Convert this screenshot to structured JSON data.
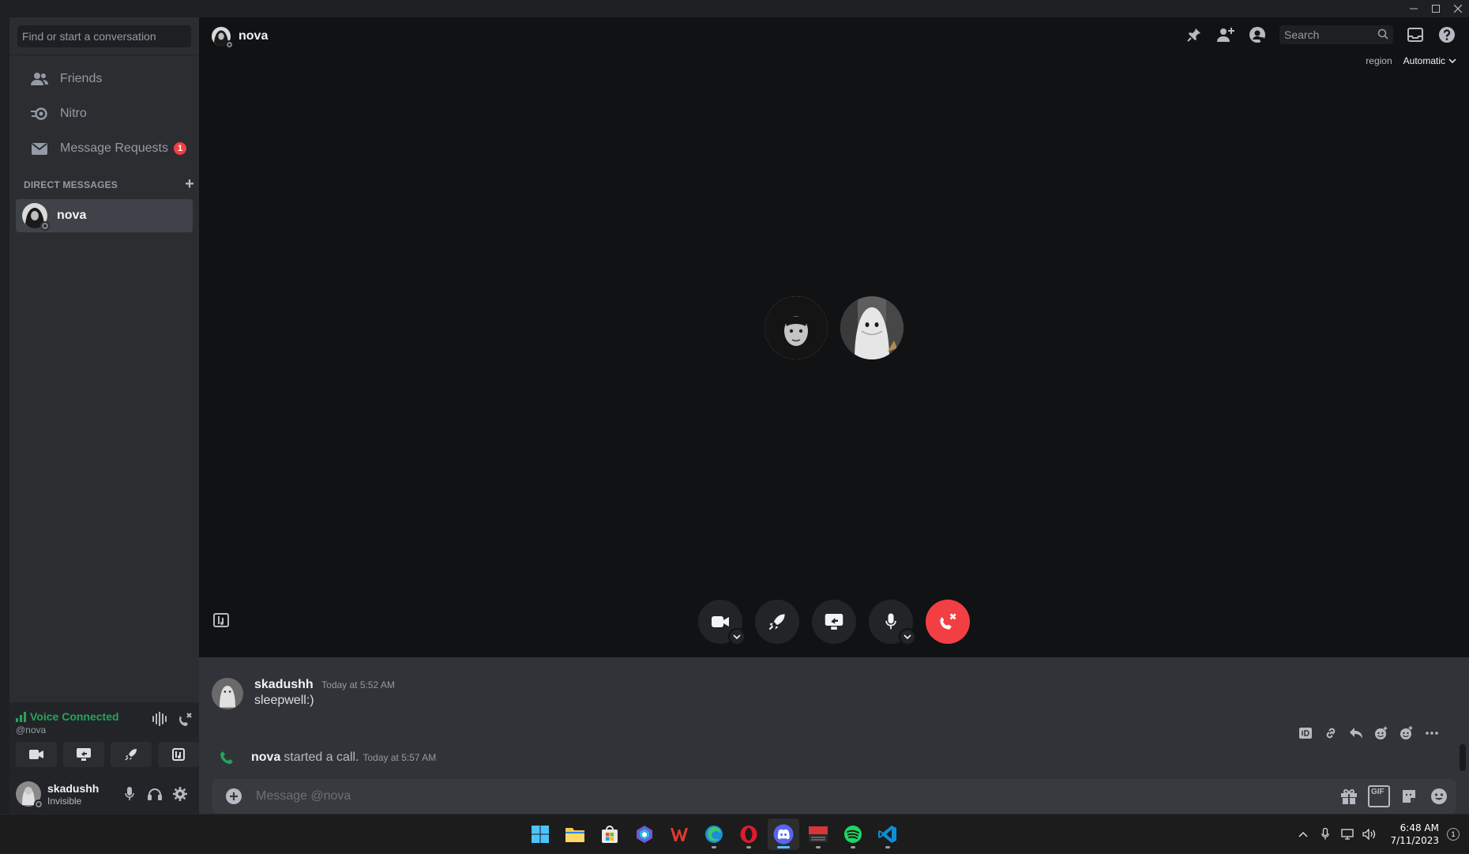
{
  "sidebar": {
    "search_placeholder": "Find or start a conversation",
    "nav": [
      {
        "label": "Friends",
        "icon": "friends-icon"
      },
      {
        "label": "Nitro",
        "icon": "nitro-icon"
      },
      {
        "label": "Message Requests",
        "icon": "envelope-icon",
        "badge": "1"
      }
    ],
    "dm_header": "DIRECT MESSAGES",
    "dm_add": "+",
    "dms": [
      {
        "name": "nova"
      }
    ]
  },
  "voice": {
    "status": "Voice Connected",
    "channel": "@nova"
  },
  "user": {
    "name": "skadushh",
    "status": "Invisible"
  },
  "header": {
    "channel_name": "nova",
    "search_placeholder": "Search",
    "region_label": "region",
    "region_value": "Automatic"
  },
  "messages": [
    {
      "author": "skadushh",
      "time": "Today at 5:52 AM",
      "text": "sleepwell:)"
    }
  ],
  "system_message": {
    "author": "nova",
    "text": "started a call.",
    "time": "Today at 5:57 AM"
  },
  "composer": {
    "placeholder": "Message @nova",
    "gif": "GIF"
  },
  "taskbar": {
    "time": "6:48 AM",
    "date": "7/11/2023",
    "notifications": "1",
    "apps": [
      "start-icon",
      "file-explorer-icon",
      "store-icon",
      "copilot-icon",
      "wps-office-icon",
      "edge-icon",
      "opera-icon",
      "discord-icon",
      "voicemeeter-icon",
      "spotify-icon",
      "vscode-icon"
    ]
  },
  "colors": {
    "brand_green": "#23a55a",
    "danger_red": "#f23f43",
    "sidebar_bg": "#2b2d31",
    "call_bg": "#111214"
  }
}
